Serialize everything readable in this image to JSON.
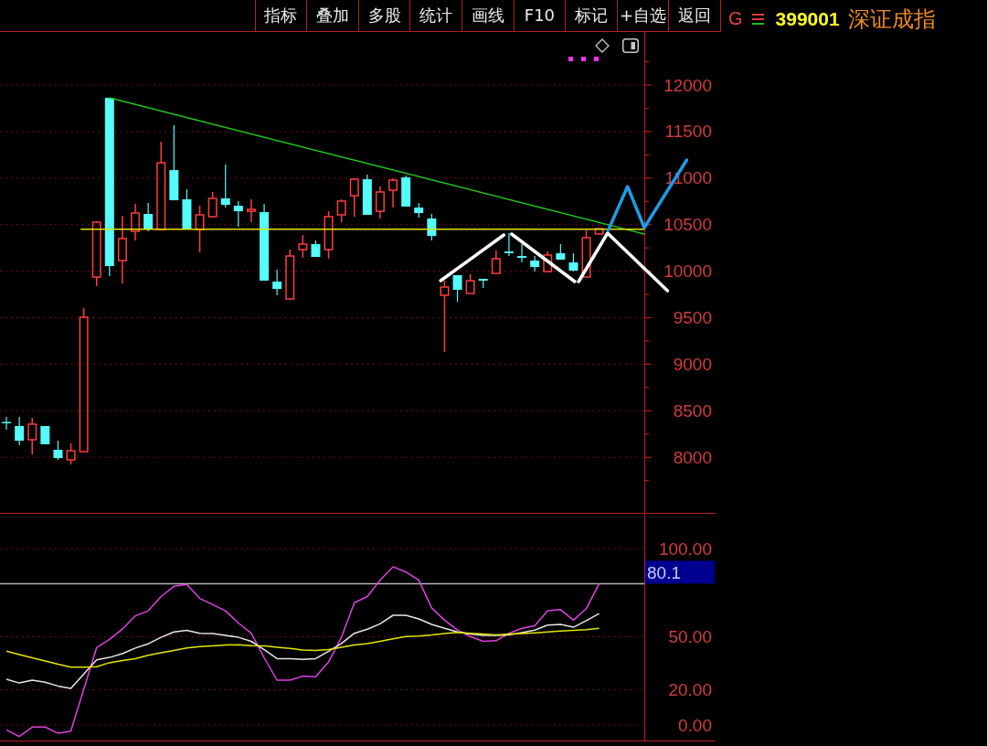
{
  "toolbar": [
    "指标",
    "叠加",
    "多股",
    "统计",
    "画线",
    "F10",
    "标记",
    "+自选",
    "返回"
  ],
  "security": {
    "flag": "G",
    "code": "399001",
    "name": "深证成指"
  },
  "price_chart": {
    "chart_data": {
      "type": "candlestick",
      "grid": true,
      "ylim": [
        7403,
        12570
      ],
      "yticks": [
        8000,
        8500,
        9000,
        9500,
        10000,
        10500,
        11000,
        11500,
        12000
      ],
      "categories": [
        null,
        null,
        null,
        null,
        null,
        null,
        null,
        null,
        null,
        null,
        null,
        null,
        null,
        null,
        null,
        null,
        null,
        null,
        null,
        null,
        null,
        null,
        null,
        null,
        null,
        null,
        null,
        null,
        null,
        null,
        null,
        null,
        null,
        null,
        null,
        null,
        null,
        null,
        null,
        null,
        null,
        null,
        null,
        null,
        null,
        null,
        null,
        null,
        null,
        null
      ],
      "ohlc": [
        [
          8380,
          8434,
          8297,
          8370
        ],
        [
          8336,
          8434,
          8130,
          8179
        ],
        [
          8189,
          8424,
          8032,
          8356
        ],
        [
          8336,
          8336,
          8140,
          8140
        ],
        [
          8081,
          8179,
          7973,
          7992
        ],
        [
          7973,
          8149,
          7924,
          8071
        ],
        [
          8061,
          9603,
          8061,
          9505
        ],
        [
          9937,
          10536,
          9839,
          10527
        ],
        [
          11862,
          11862,
          9947,
          10055
        ],
        [
          10114,
          10595,
          9868,
          10350
        ],
        [
          10428,
          10723,
          10330,
          10625
        ],
        [
          10615,
          10733,
          10428,
          10448
        ],
        [
          10448,
          11391,
          10448,
          11165
        ],
        [
          11086,
          11568,
          10762,
          10762
        ],
        [
          10772,
          10880,
          10448,
          10448
        ],
        [
          10448,
          10703,
          10202,
          10605
        ],
        [
          10586,
          10851,
          10576,
          10782
        ],
        [
          10782,
          11145,
          10684,
          10713
        ],
        [
          10703,
          10752,
          10478,
          10644
        ],
        [
          10644,
          10772,
          10527,
          10664
        ],
        [
          10635,
          10723,
          9898,
          9898
        ],
        [
          9888,
          10016,
          9741,
          9809
        ],
        [
          9701,
          10232,
          9701,
          10163
        ],
        [
          10232,
          10389,
          10143,
          10291
        ],
        [
          10291,
          10330,
          10153,
          10153
        ],
        [
          10232,
          10644,
          10134,
          10586
        ],
        [
          10605,
          10772,
          10527,
          10753
        ],
        [
          10811,
          10998,
          10586,
          10988
        ],
        [
          10988,
          11037,
          10605,
          10605
        ],
        [
          10644,
          10910,
          10566,
          10851
        ],
        [
          10870,
          10998,
          10684,
          10978
        ],
        [
          11008,
          11027,
          10694,
          10694
        ],
        [
          10684,
          10733,
          10576,
          10625
        ],
        [
          10566,
          10615,
          10330,
          10379
        ],
        [
          9741,
          9898,
          9132,
          9829
        ],
        [
          9957,
          9957,
          9672,
          9800
        ],
        [
          9760,
          9967,
          9760,
          9898
        ],
        [
          9918,
          9918,
          9819,
          9898
        ],
        [
          9976,
          10222,
          9976,
          10134
        ],
        [
          10212,
          10409,
          10163,
          10193
        ],
        [
          10163,
          10291,
          10094,
          10143
        ],
        [
          10114,
          10163,
          9996,
          10045
        ],
        [
          9996,
          10212,
          9996,
          10173
        ],
        [
          10193,
          10291,
          10124,
          10124
        ],
        [
          10094,
          10193,
          9996,
          10006
        ],
        [
          9937,
          10438,
          9937,
          10360
        ],
        [
          10399,
          10458,
          10399,
          10458
        ],
        null,
        null,
        null
      ]
    }
  },
  "indicator_chart": {
    "chart_data": {
      "type": "line",
      "grid": true,
      "ylim": [
        -8.8,
        119.7
      ],
      "yticks": [
        {
          "value": 0,
          "label": "0.00"
        },
        {
          "value": 20,
          "label": "20.00"
        },
        {
          "value": 50,
          "label": "50.00"
        },
        {
          "value": 100,
          "label": "100.00"
        }
      ],
      "categories": [
        null,
        null,
        null,
        null,
        null,
        null,
        null,
        null,
        null,
        null,
        null,
        null,
        null,
        null,
        null,
        null,
        null,
        null,
        null,
        null,
        null,
        null,
        null,
        null,
        null,
        null,
        null,
        null,
        null,
        null,
        null,
        null,
        null,
        null,
        null,
        null,
        null,
        null,
        null,
        null,
        null,
        null,
        null,
        null,
        null,
        null,
        null,
        null,
        null,
        null
      ],
      "series": [
        {
          "color": "#e040e0",
          "values": [
            -2.8,
            -6.5,
            -1.2,
            -1.2,
            -4.7,
            -3.5,
            20.3,
            43.9,
            48.5,
            54.3,
            61.9,
            64.7,
            72.8,
            78.6,
            79.7,
            71.7,
            68.2,
            64.7,
            57.8,
            52.0,
            38.1,
            25.4,
            25.4,
            27.7,
            27.3,
            35.8,
            49.7,
            69.3,
            72.8,
            82.1,
            89.7,
            86.7,
            82.1,
            66.3,
            59.4,
            53.8,
            50.1,
            47.4,
            47.8,
            52.0,
            54.8,
            56.2,
            64.7,
            65.4,
            59.4,
            65.9,
            80.1,
            null,
            null,
            null
          ]
        },
        {
          "color": "#e6e6e6",
          "values": [
            25.9,
            23.8,
            25.4,
            24.2,
            22.1,
            20.8,
            28.9,
            36.9,
            38.3,
            40.4,
            43.6,
            46.0,
            49.7,
            52.7,
            53.6,
            52.0,
            51.8,
            50.8,
            49.7,
            47.4,
            42.7,
            37.6,
            37.6,
            37.2,
            37.6,
            41.8,
            46.2,
            52.0,
            54.3,
            57.3,
            62.2,
            62.2,
            60.1,
            57.0,
            54.8,
            52.7,
            51.5,
            50.8,
            50.8,
            51.0,
            52.4,
            53.8,
            56.6,
            57.0,
            55.4,
            59.2,
            63.1,
            null,
            null,
            null
          ]
        },
        {
          "color": "#e6e600",
          "values": [
            41.8,
            39.9,
            38.1,
            36.3,
            34.4,
            32.8,
            32.8,
            33.0,
            35.3,
            36.5,
            37.6,
            39.5,
            40.9,
            42.3,
            43.7,
            44.4,
            44.8,
            45.3,
            45.5,
            45.0,
            44.8,
            44.1,
            43.4,
            42.5,
            42.3,
            42.7,
            44.1,
            45.3,
            46.2,
            47.4,
            48.8,
            50.1,
            50.4,
            51.0,
            51.8,
            52.5,
            52.0,
            51.5,
            51.0,
            51.5,
            51.8,
            52.2,
            52.7,
            53.2,
            53.6,
            54.0,
            54.8,
            null,
            null,
            null
          ]
        }
      ],
      "ref_lines": [
        {
          "axis": "y",
          "value": 80.1,
          "label": "80.1"
        }
      ]
    }
  }
}
